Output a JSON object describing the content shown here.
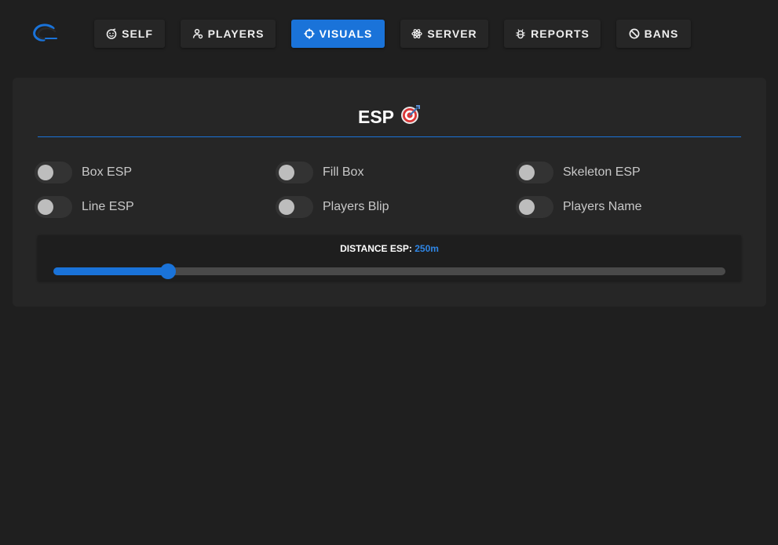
{
  "nav": {
    "items": [
      {
        "label": "SELF",
        "icon": "smiley-icon",
        "active": false
      },
      {
        "label": "PLAYERS",
        "icon": "users-icon",
        "active": false
      },
      {
        "label": "VISUALS",
        "icon": "crosshair-icon",
        "active": true
      },
      {
        "label": "SERVER",
        "icon": "atom-icon",
        "active": false
      },
      {
        "label": "REPORTS",
        "icon": "bug-icon",
        "active": false
      },
      {
        "label": "BANS",
        "icon": "ban-icon",
        "active": false
      }
    ]
  },
  "panel": {
    "title": "ESP",
    "title_icon": "target-icon",
    "toggles": [
      {
        "label": "Box ESP",
        "on": false
      },
      {
        "label": "Fill Box",
        "on": false
      },
      {
        "label": "Skeleton ESP",
        "on": false
      },
      {
        "label": "Line ESP",
        "on": false
      },
      {
        "label": "Players Blip",
        "on": false
      },
      {
        "label": "Players Name",
        "on": false
      }
    ],
    "distance": {
      "label": "DISTANCE ESP:",
      "value_text": "250m",
      "value_fraction": 0.17
    }
  },
  "colors": {
    "accent": "#1a73d9",
    "background": "#1f1f1f",
    "panel": "#262626"
  }
}
